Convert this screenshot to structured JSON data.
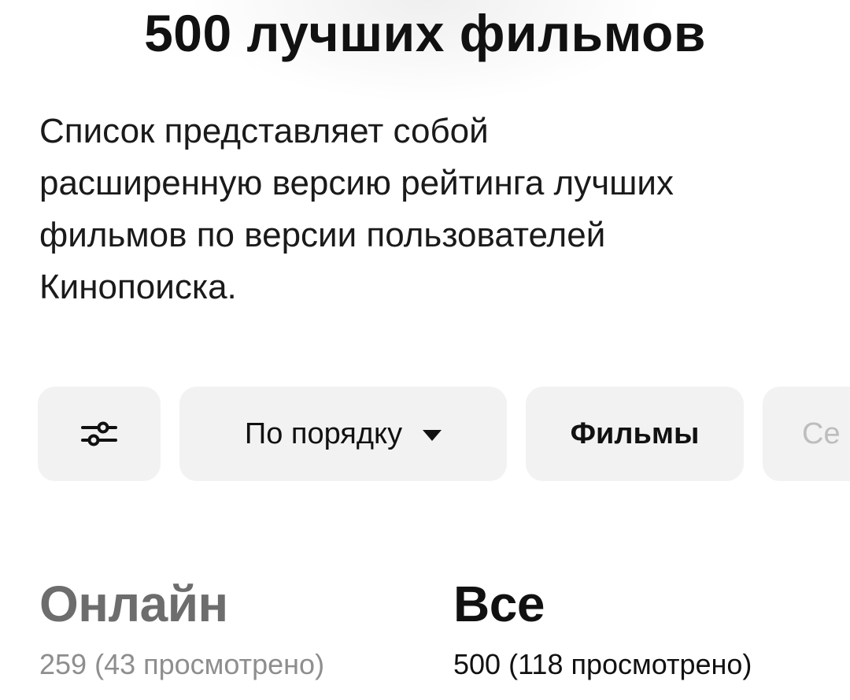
{
  "header": {
    "title": "500 лучших фильмов"
  },
  "description": {
    "line1": "Список представляет собой",
    "line2": "расширенную версию рейтинга лучших",
    "line3": "фильмов по версии пользователей",
    "line4": "Кинопоиска."
  },
  "filters": {
    "settings_icon": "sliders-icon",
    "sort_label": "По порядку",
    "sort_icon": "caret-down-icon",
    "films_label": "Фильмы",
    "series_label": "Се"
  },
  "tabs": {
    "online": {
      "title": "Онлайн",
      "count": "259",
      "watched": "(43 просмотрено)"
    },
    "all": {
      "title": "Все",
      "count": "500",
      "watched": "(118 просмотрено)"
    }
  },
  "colors": {
    "chip_bg": "#f2f2f2",
    "text_primary": "#111111",
    "text_muted": "#8e8e8e",
    "text_inactive_tab": "#6d6d6d"
  }
}
